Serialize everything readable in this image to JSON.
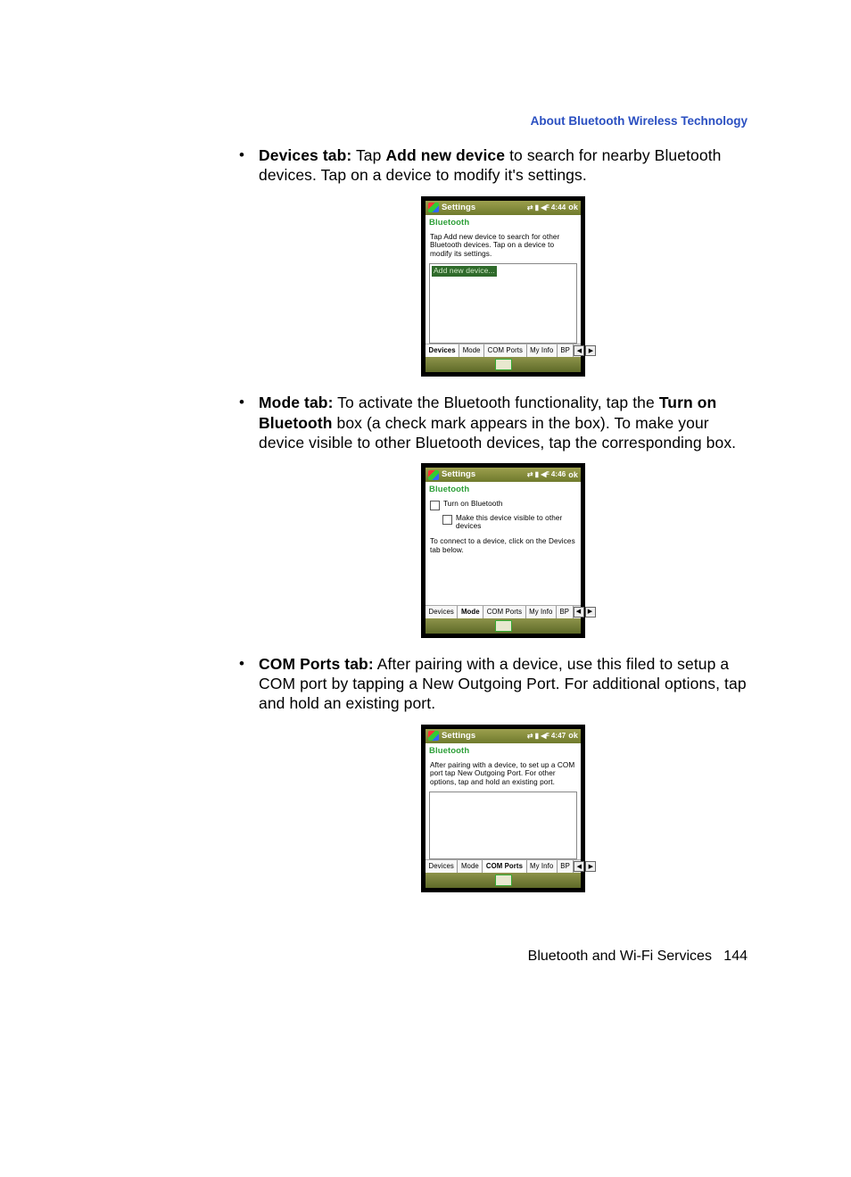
{
  "header": {
    "section_title": "About Bluetooth Wireless Technology"
  },
  "bullets": {
    "devices": {
      "label": "Devices tab:",
      "text_before_bold": " Tap ",
      "bold_inline": "Add new device",
      "text": " to search for nearby Bluetooth devices. Tap on a device to modify it's settings."
    },
    "mode": {
      "label": "Mode tab:",
      "text_before_bold": " To activate the Bluetooth functionality, tap the ",
      "bold_inline": "Turn on Bluetooth",
      "text": " box (a check mark appears in the box). To make your device visible to other Bluetooth devices, tap the corresponding box."
    },
    "com": {
      "label": "COM Ports tab:",
      "text": " After pairing with a device, use this filed to setup a COM port by tapping a New Outgoing Port. For additional options, tap and hold an existing port."
    }
  },
  "shots": {
    "common": {
      "titlebar_title": "Settings",
      "ok": "ok",
      "sub": "Bluetooth",
      "tabs": {
        "devices": "Devices",
        "mode": "Mode",
        "com": "COM Ports",
        "myinfo": "My Info",
        "bp": "BP"
      }
    },
    "devices": {
      "time": "4:44",
      "instr": "Tap Add new device to search for other Bluetooth devices. Tap on a device to modify its settings.",
      "link": "Add new device..."
    },
    "mode": {
      "time": "4:46",
      "chk1": "Turn on Bluetooth",
      "chk2": "Make this device visible to other devices",
      "instr": "To connect to a device, click on the Devices tab below."
    },
    "com": {
      "time": "4:47",
      "instr": "After pairing with a device, to set up a COM port tap New Outgoing Port. For other options, tap and hold an existing port."
    }
  },
  "footer": {
    "text": "Bluetooth and Wi-Fi Services",
    "page": "144"
  }
}
